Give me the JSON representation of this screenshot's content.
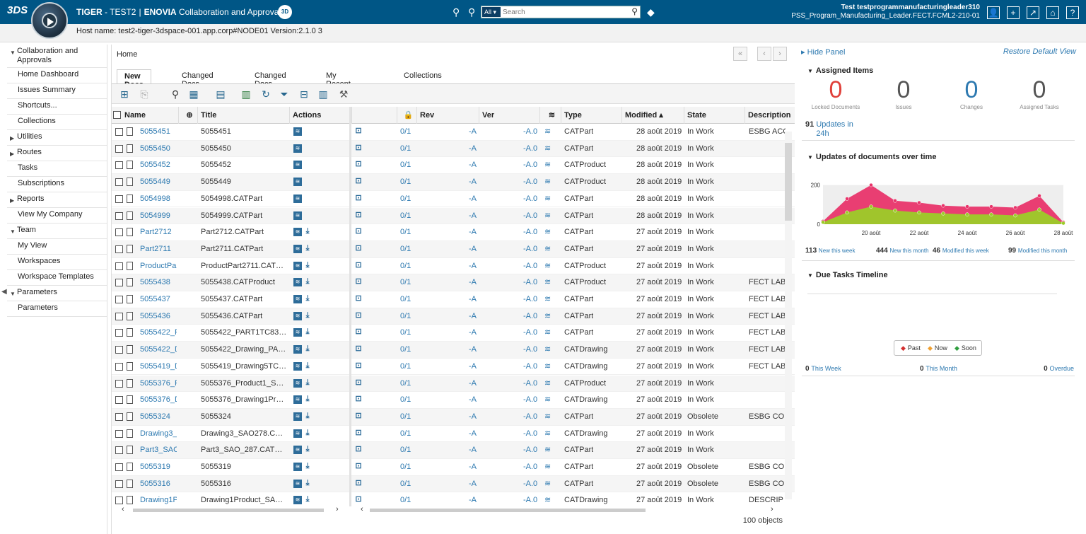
{
  "header": {
    "logo": "3DS",
    "app_name_bold": "TIGER",
    "app_name_rest": " - TEST2",
    "separator": "|",
    "product": "ENOVIA",
    "product_rest": " Collaboration and Approvals",
    "badge": "3D",
    "search_scope": "All",
    "search_placeholder": "Search",
    "user_name": "Test testprogrammanufacturingleader310",
    "user_role": "PSS_Program_Manufacturing_Leader.FECT.FCML2-210-01"
  },
  "host": "Host name: test2-tiger-3dspace-001.app.corp#NODE01 Version:2.1.0 3",
  "sidebar": {
    "items": [
      {
        "label": "Collaboration and Approvals",
        "expanded": true,
        "type": "group"
      },
      {
        "label": "Home Dashboard",
        "type": "sub"
      },
      {
        "label": "Issues Summary",
        "type": "sub"
      },
      {
        "label": "Shortcuts...",
        "type": "sub"
      },
      {
        "label": "Collections",
        "type": "sub"
      },
      {
        "label": "Utilities",
        "expanded": false,
        "type": "group"
      },
      {
        "label": "Routes",
        "expanded": false,
        "type": "group"
      },
      {
        "label": "Tasks",
        "type": "sub"
      },
      {
        "label": "Subscriptions",
        "type": "sub"
      },
      {
        "label": "Reports",
        "expanded": false,
        "type": "group"
      },
      {
        "label": "View My Company",
        "type": "sub"
      },
      {
        "label": "Team",
        "expanded": true,
        "type": "group"
      },
      {
        "label": "My View",
        "type": "sub"
      },
      {
        "label": "Workspaces",
        "type": "sub"
      },
      {
        "label": "Workspace Templates",
        "type": "sub"
      },
      {
        "label": "Parameters",
        "expanded": true,
        "type": "group"
      },
      {
        "label": "Parameters",
        "type": "sub"
      }
    ]
  },
  "main": {
    "breadcrumb": "Home",
    "tabs": [
      "New Docs",
      "Changed Docs",
      "Changed Docs",
      "My Recent Docs",
      "Collections"
    ],
    "active_tab": 0,
    "columns": [
      "Name",
      "Title",
      "Actions",
      "Rev",
      "Ver",
      "Type",
      "Modified",
      "State",
      "Description"
    ],
    "rows": [
      {
        "name": "5055451",
        "title": "5055451",
        "dl": false,
        "rev_frac": "0/1",
        "rev": "-A",
        "ver": "-A.0",
        "type": "CATPart",
        "modified": "28 août 2019",
        "state": "In Work",
        "desc": "ESBG ACC"
      },
      {
        "name": "5055450",
        "title": "5055450",
        "dl": false,
        "rev_frac": "0/1",
        "rev": "-A",
        "ver": "-A.0",
        "type": "CATPart",
        "modified": "28 août 2019",
        "state": "In Work",
        "desc": ""
      },
      {
        "name": "5055452",
        "title": "5055452",
        "dl": false,
        "rev_frac": "0/1",
        "rev": "-A",
        "ver": "-A.0",
        "type": "CATProduct",
        "modified": "28 août 2019",
        "state": "In Work",
        "desc": ""
      },
      {
        "name": "5055449",
        "title": "5055449",
        "dl": false,
        "rev_frac": "0/1",
        "rev": "-A",
        "ver": "-A.0",
        "type": "CATProduct",
        "modified": "28 août 2019",
        "state": "In Work",
        "desc": ""
      },
      {
        "name": "5054998",
        "title": "5054998.CATPart",
        "dl": false,
        "rev_frac": "0/1",
        "rev": "-A",
        "ver": "-A.0",
        "type": "CATPart",
        "modified": "28 août 2019",
        "state": "In Work",
        "desc": ""
      },
      {
        "name": "5054999",
        "title": "5054999.CATPart",
        "dl": false,
        "rev_frac": "0/1",
        "rev": "-A",
        "ver": "-A.0",
        "type": "CATPart",
        "modified": "28 août 2019",
        "state": "In Work",
        "desc": ""
      },
      {
        "name": "Part2712",
        "title": "Part2712.CATPart",
        "dl": true,
        "rev_frac": "0/1",
        "rev": "-A",
        "ver": "-A.0",
        "type": "CATPart",
        "modified": "27 août 2019",
        "state": "In Work",
        "desc": ""
      },
      {
        "name": "Part2711",
        "title": "Part2711.CATPart",
        "dl": true,
        "rev_frac": "0/1",
        "rev": "-A",
        "ver": "-A.0",
        "type": "CATPart",
        "modified": "27 août 2019",
        "state": "In Work",
        "desc": ""
      },
      {
        "name": "ProductPar",
        "title": "ProductPart2711.CAT…",
        "dl": true,
        "rev_frac": "0/1",
        "rev": "-A",
        "ver": "-A.0",
        "type": "CATProduct",
        "modified": "27 août 2019",
        "state": "In Work",
        "desc": ""
      },
      {
        "name": "5055438",
        "title": "5055438.CATProduct",
        "dl": true,
        "rev_frac": "0/1",
        "rev": "-A",
        "ver": "-A.0",
        "type": "CATProduct",
        "modified": "27 août 2019",
        "state": "In Work",
        "desc": "FECT LAB"
      },
      {
        "name": "5055437",
        "title": "5055437.CATPart",
        "dl": true,
        "rev_frac": "0/1",
        "rev": "-A",
        "ver": "-A.0",
        "type": "CATPart",
        "modified": "27 août 2019",
        "state": "In Work",
        "desc": "FECT LAB"
      },
      {
        "name": "5055436",
        "title": "5055436.CATPart",
        "dl": true,
        "rev_frac": "0/1",
        "rev": "-A",
        "ver": "-A.0",
        "type": "CATPart",
        "modified": "27 août 2019",
        "state": "In Work",
        "desc": "FECT LAB"
      },
      {
        "name": "5055422_F",
        "title": "5055422_PART1TC83…",
        "dl": true,
        "rev_frac": "0/1",
        "rev": "-A",
        "ver": "-A.0",
        "type": "CATPart",
        "modified": "27 août 2019",
        "state": "In Work",
        "desc": "FECT LAB"
      },
      {
        "name": "5055422_D",
        "title": "5055422_Drawing_PA…",
        "dl": true,
        "rev_frac": "0/1",
        "rev": "-A",
        "ver": "-A.0",
        "type": "CATDrawing",
        "modified": "27 août 2019",
        "state": "In Work",
        "desc": "FECT LAB"
      },
      {
        "name": "5055419_D",
        "title": "5055419_Drawing5TC…",
        "dl": true,
        "rev_frac": "0/1",
        "rev": "-A",
        "ver": "-A.0",
        "type": "CATDrawing",
        "modified": "27 août 2019",
        "state": "In Work",
        "desc": "FECT LAB"
      },
      {
        "name": "5055376_F",
        "title": "5055376_Product1_S…",
        "dl": true,
        "rev_frac": "0/1",
        "rev": "-A",
        "ver": "-A.0",
        "type": "CATProduct",
        "modified": "27 août 2019",
        "state": "In Work",
        "desc": ""
      },
      {
        "name": "5055376_D",
        "title": "5055376_Drawing1Pr…",
        "dl": true,
        "rev_frac": "0/1",
        "rev": "-A",
        "ver": "-A.0",
        "type": "CATDrawing",
        "modified": "27 août 2019",
        "state": "In Work",
        "desc": ""
      },
      {
        "name": "5055324",
        "title": "5055324",
        "dl": true,
        "rev_frac": "0/1",
        "rev": "-A",
        "ver": "-A.0",
        "type": "CATPart",
        "modified": "27 août 2019",
        "state": "Obsolete",
        "desc": "ESBG CO"
      },
      {
        "name": "Drawing3_",
        "title": "Drawing3_SAO278.C…",
        "dl": true,
        "rev_frac": "0/1",
        "rev": "-A",
        "ver": "-A.0",
        "type": "CATDrawing",
        "modified": "27 août 2019",
        "state": "In Work",
        "desc": ""
      },
      {
        "name": "Part3_SAC",
        "title": "Part3_SAO_287.CAT…",
        "dl": true,
        "rev_frac": "0/1",
        "rev": "-A",
        "ver": "-A.0",
        "type": "CATPart",
        "modified": "27 août 2019",
        "state": "In Work",
        "desc": ""
      },
      {
        "name": "5055319",
        "title": "5055319",
        "dl": true,
        "rev_frac": "0/1",
        "rev": "-A",
        "ver": "-A.0",
        "type": "CATPart",
        "modified": "27 août 2019",
        "state": "Obsolete",
        "desc": "ESBG CO"
      },
      {
        "name": "5055316",
        "title": "5055316",
        "dl": true,
        "rev_frac": "0/1",
        "rev": "-A",
        "ver": "-A.0",
        "type": "CATPart",
        "modified": "27 août 2019",
        "state": "Obsolete",
        "desc": "ESBG CO"
      },
      {
        "name": "Drawing1P",
        "title": "Drawing1Product_SA…",
        "dl": true,
        "rev_frac": "0/1",
        "rev": "-A",
        "ver": "-A.0",
        "type": "CATDrawing",
        "modified": "27 août 2019",
        "state": "In Work",
        "desc": "DESCRIP"
      }
    ],
    "object_count": "100 objects"
  },
  "panel": {
    "hide_label": "Hide Panel",
    "restore_label": "Restore Default View",
    "assigned_title": "Assigned Items",
    "kpis": [
      {
        "value": "0",
        "label": "Locked Documents",
        "color": "#e0403a"
      },
      {
        "value": "0",
        "label": "Issues",
        "color": "#555555"
      },
      {
        "value": "0",
        "label": "Changes",
        "color": "#2d79b0"
      },
      {
        "value": "0",
        "label": "Assigned Tasks",
        "color": "#555555"
      }
    ],
    "updates_count": "91",
    "updates_label": "Updates in 24h",
    "chart_title": "Updates of documents over time",
    "stats": [
      {
        "value": "113",
        "label": "New this week"
      },
      {
        "value": "444",
        "label": "New this month"
      },
      {
        "value": "46",
        "label": "Modified this week"
      },
      {
        "value": "99",
        "label": "Modified this month"
      }
    ],
    "due_title": "Due Tasks Timeline",
    "legend": [
      {
        "label": "Past",
        "color": "#d32f2f"
      },
      {
        "label": "Now",
        "color": "#f0a030"
      },
      {
        "label": "Soon",
        "color": "#2e9e3e"
      }
    ],
    "due_stats": [
      {
        "value": "0",
        "label": "This Week"
      },
      {
        "value": "0",
        "label": "This Month"
      },
      {
        "value": "0",
        "label": "Overdue"
      }
    ]
  },
  "chart_data": {
    "type": "area",
    "title": "Updates of documents over time",
    "x": [
      "18 août",
      "19 août",
      "20 août",
      "21 août",
      "22 août",
      "23 août",
      "24 août",
      "25 août",
      "26 août",
      "27 août",
      "28 août"
    ],
    "x_ticks": [
      "20 août",
      "22 août",
      "24 août",
      "26 août",
      "28 août"
    ],
    "y_ticks": [
      0,
      200
    ],
    "ylim": [
      0,
      260
    ],
    "series": [
      {
        "color": "#e8346a",
        "values": [
          15,
          130,
          200,
          120,
          110,
          95,
          90,
          90,
          85,
          145,
          10
        ]
      },
      {
        "color": "#9ccc28",
        "values": [
          10,
          60,
          90,
          70,
          60,
          55,
          50,
          50,
          45,
          75,
          5
        ]
      }
    ]
  }
}
